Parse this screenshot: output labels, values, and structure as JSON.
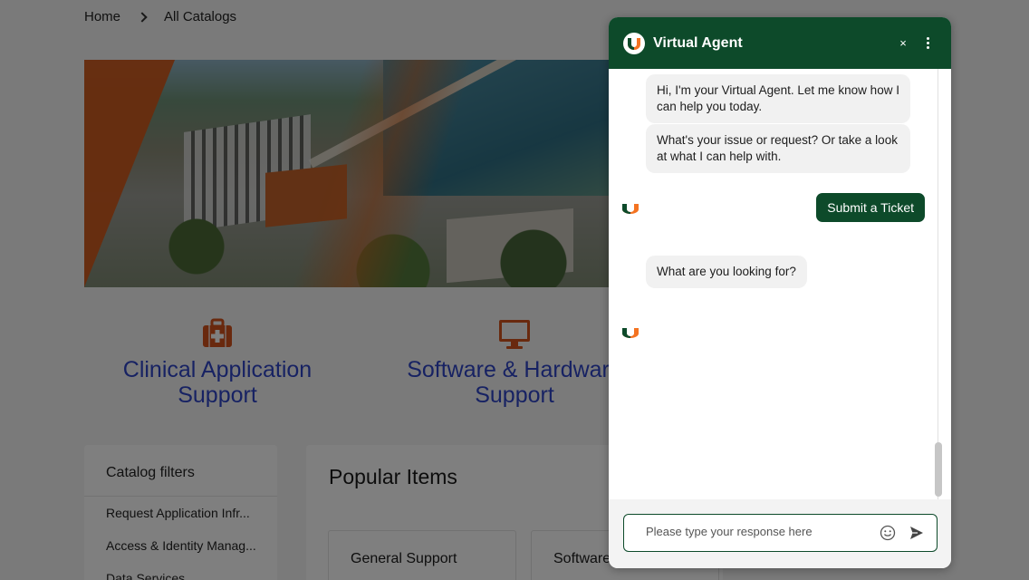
{
  "breadcrumb": {
    "home": "Home",
    "current": "All Catalogs"
  },
  "categories": [
    {
      "label_line1": "Clinical Application",
      "label_line2": "Support",
      "icon": "first-aid-kit-icon"
    },
    {
      "label_line1": "Software & Hardware",
      "label_line2": "Support",
      "icon": "monitor-icon"
    }
  ],
  "filters": {
    "title": "Catalog filters",
    "items": [
      "Request Application Infr...",
      "Access & Identity Manag...",
      "Data Services"
    ]
  },
  "popular": {
    "title": "Popular Items",
    "cards": [
      "General Support",
      "Software"
    ]
  },
  "virtual_agent": {
    "title": "Virtual Agent",
    "close_glyph": "×",
    "messages": {
      "greeting": "Hi, I'm your Virtual Agent. Let me know how I can help you today.",
      "prompt": "What's your issue or request? Or take a look at what I can help with.",
      "user_choice": "Submit a Ticket",
      "question": "What are you looking for?"
    },
    "input": {
      "placeholder": "Please type your response here",
      "value": ""
    }
  },
  "colors": {
    "brand_green": "#0d4a2a",
    "brand_orange": "#f47321",
    "link_blue": "#2e44c6",
    "icon_orange": "#d2521c"
  }
}
